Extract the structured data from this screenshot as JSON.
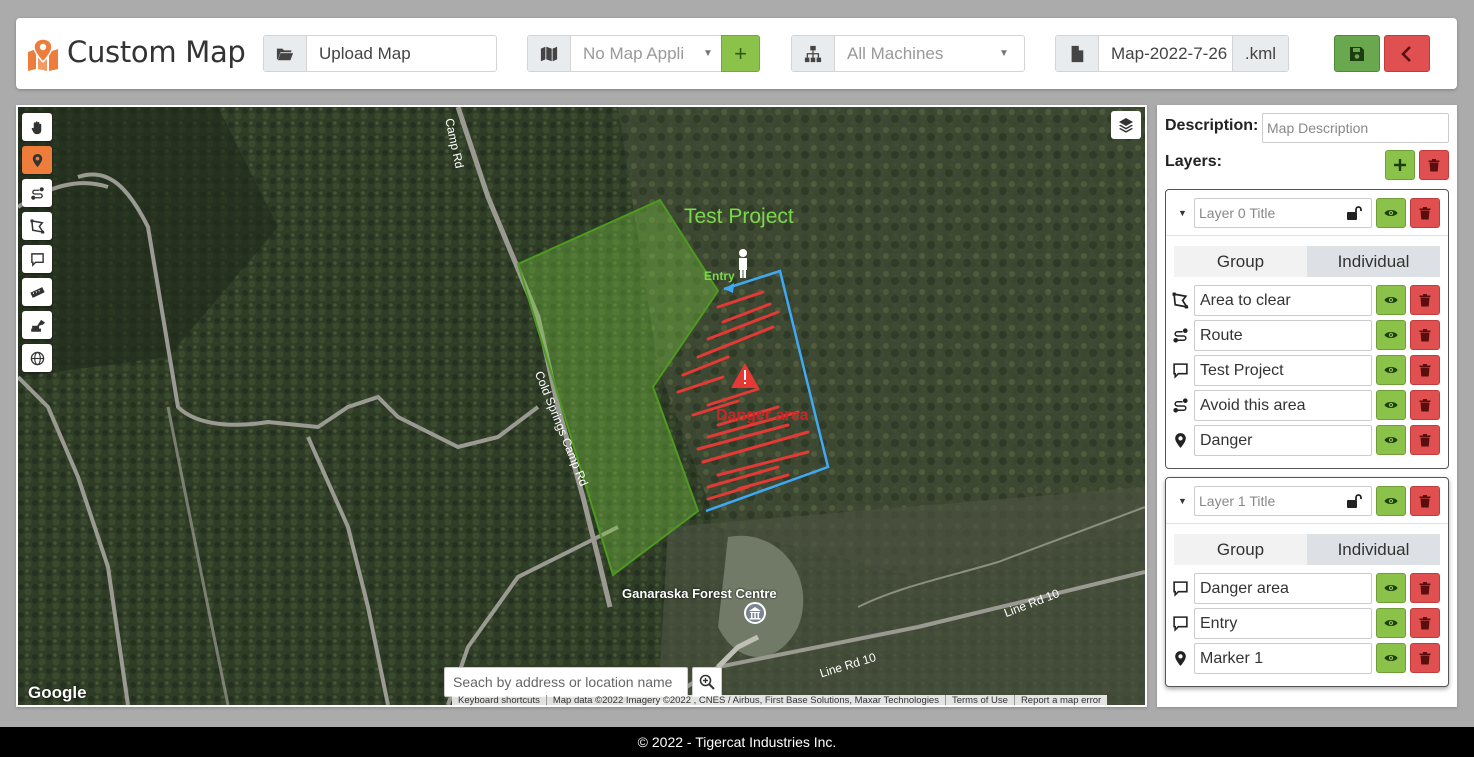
{
  "app": {
    "title": "Custom Map"
  },
  "header": {
    "upload": {
      "placeholder": "Upload Map",
      "icon": "folder-open-icon"
    },
    "map_app": {
      "value": "No Map Appli",
      "icon": "map-icon"
    },
    "machines": {
      "value": "All Machines",
      "icon": "sitemap-icon"
    },
    "filename": {
      "value": "Map-2022-7-26",
      "extension": ".kml",
      "icon": "file-icon"
    },
    "add_icon": "plus-icon",
    "save_icon": "save-icon",
    "back_icon": "chevron-left-icon"
  },
  "colors": {
    "accent_orange": "#ee7d3b",
    "green_button": "#8bc34a",
    "red_button": "#e05050",
    "polygon_green": "#7ac943",
    "route_blue": "#3fa9f5",
    "danger_red": "#e53935"
  },
  "map": {
    "toolbar": [
      "hand-icon",
      "marker-icon",
      "route-icon",
      "polygon-icon",
      "comment-icon",
      "ruler-icon",
      "machine-icon",
      "globe-icon"
    ],
    "layers_icon": "layers-icon",
    "labels": {
      "test_project": "Test Project",
      "entry": "Entry",
      "danger_area": "Danger area",
      "road_top": "Camp Rd",
      "road_main": "Cold Springs Camp Rd",
      "poi": "Ganaraska Forest Centre",
      "line_rd_a": "Line Rd 10",
      "line_rd_b": "Line Rd 10"
    },
    "search_placeholder": "Seach by address or location name",
    "google": "Google",
    "attribution": [
      "Keyboard shortcuts",
      "Map data ©2022 Imagery ©2022 , CNES / Airbus, First Base Solutions, Maxar Technologies",
      "Terms of Use",
      "Report a map error"
    ]
  },
  "panel": {
    "description_label": "Description:",
    "description_placeholder": "Map Description",
    "layers_label": "Layers:",
    "layers": [
      {
        "title_placeholder": "Layer 0 Title",
        "tabs": [
          "Group",
          "Individual"
        ],
        "items": [
          {
            "name": "Area to clear",
            "icon": "polygon-icon"
          },
          {
            "name": "Route",
            "icon": "route-icon"
          },
          {
            "name": "Test Project",
            "icon": "comment-icon"
          },
          {
            "name": "Avoid this area",
            "icon": "route-icon"
          },
          {
            "name": "Danger",
            "icon": "marker-icon"
          }
        ]
      },
      {
        "title_placeholder": "Layer 1 Title",
        "tabs": [
          "Group",
          "Individual"
        ],
        "items": [
          {
            "name": "Danger area",
            "icon": "comment-icon"
          },
          {
            "name": "Entry",
            "icon": "comment-icon"
          },
          {
            "name": "Marker 1",
            "icon": "marker-icon"
          }
        ]
      }
    ]
  },
  "footer": {
    "text": "© 2022 - Tigercat Industries Inc."
  }
}
